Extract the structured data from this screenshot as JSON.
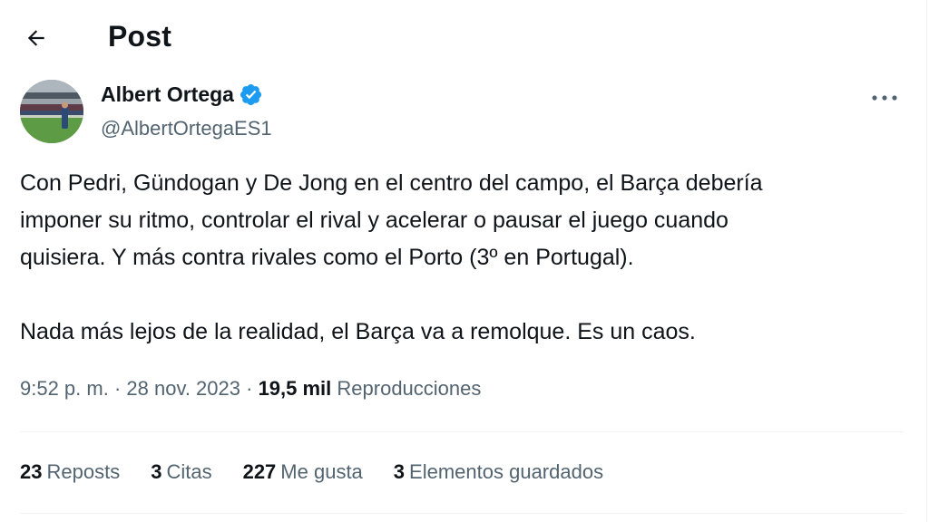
{
  "header": {
    "title": "Post",
    "back_icon": "arrow-left-icon"
  },
  "author": {
    "name": "Albert Ortega",
    "handle": "@AlbertOrtegaES1",
    "verified_icon": "verified-badge-icon",
    "verified_color": "#1d9bf0"
  },
  "tweet": {
    "paragraphs": [
      "Con Pedri, Gündogan y De Jong en el centro del campo, el Barça debería\nimponer su ritmo, controlar el rival y acelerar o pausar el juego cuando\nquisiera. Y más contra rivales como el Porto (3º en Portugal).",
      "Nada más lejos de la realidad, el Barça va a remolque. Es un caos."
    ]
  },
  "meta": {
    "time": "9:52 p. m.",
    "separator": " · ",
    "date": "28 nov. 2023",
    "views_count": "19,5 mil",
    "views_label": "Reproducciones"
  },
  "stats": [
    {
      "count": "23",
      "label": "Reposts"
    },
    {
      "count": "3",
      "label": "Citas"
    },
    {
      "count": "227",
      "label": "Me gusta"
    },
    {
      "count": "3",
      "label": "Elementos guardados"
    }
  ],
  "icons": {
    "more": "more-horizontal-icon"
  },
  "colors": {
    "text": "#0f1419",
    "secondary": "#536471",
    "divider": "#eff3f4",
    "accent": "#1d9bf0"
  }
}
